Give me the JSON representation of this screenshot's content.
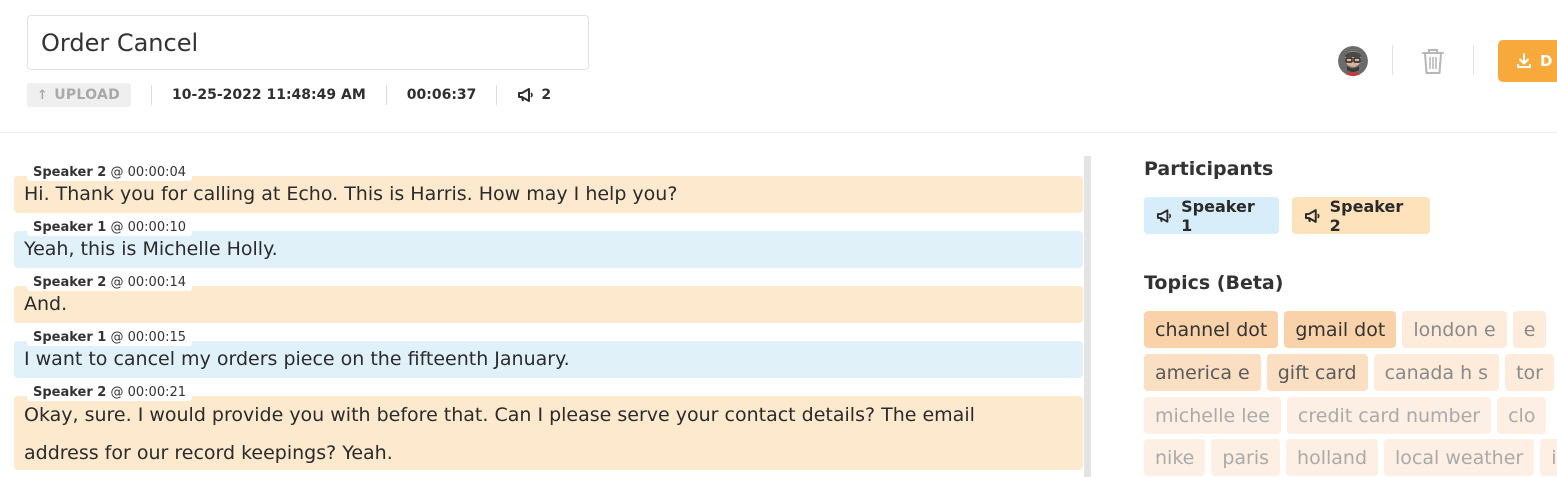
{
  "header": {
    "title_value": "Order Cancel",
    "upload_label": "UPLOAD",
    "datetime": "10-25-2022 11:48:49 AM",
    "duration": "00:06:37",
    "speaker_count": "2",
    "download_label": "D",
    "accent_color": "#f7a93b"
  },
  "transcript": {
    "utterances": [
      {
        "speaker": "Speaker 2",
        "time": "@ 00:00:04",
        "lines": [
          "Hi. Thank you for calling at Echo. This is Harris. How may I help you?"
        ]
      },
      {
        "speaker": "Speaker 1",
        "time": "@ 00:00:10",
        "lines": [
          "Yeah, this is Michelle Holly."
        ]
      },
      {
        "speaker": "Speaker 2",
        "time": "@ 00:00:14",
        "lines": [
          "And."
        ]
      },
      {
        "speaker": "Speaker 1",
        "time": "@ 00:00:15",
        "lines": [
          "I want to cancel my orders piece on the fifteenth January."
        ]
      },
      {
        "speaker": "Speaker 2",
        "time": "@ 00:00:21",
        "lines": [
          "Okay, sure. I would provide you with before that. Can I please serve your contact details? The email",
          "address for our record keepings? Yeah."
        ]
      }
    ],
    "speaker_colors": {
      "Speaker 1": "#e0f1fa",
      "Speaker 2": "#fde9cd"
    }
  },
  "participants": {
    "heading": "Participants",
    "items": [
      "Speaker 1",
      "Speaker 2"
    ]
  },
  "topics": {
    "heading": "Topics (Beta)",
    "rows": [
      [
        "channel dot",
        "gmail dot",
        "london e",
        "e"
      ],
      [
        "america e",
        "gift card",
        "canada h s",
        "tor"
      ],
      [
        "michelle lee",
        "credit card number",
        "clo"
      ],
      [
        "nike",
        "paris",
        "holland",
        "local weather",
        "i"
      ]
    ]
  }
}
